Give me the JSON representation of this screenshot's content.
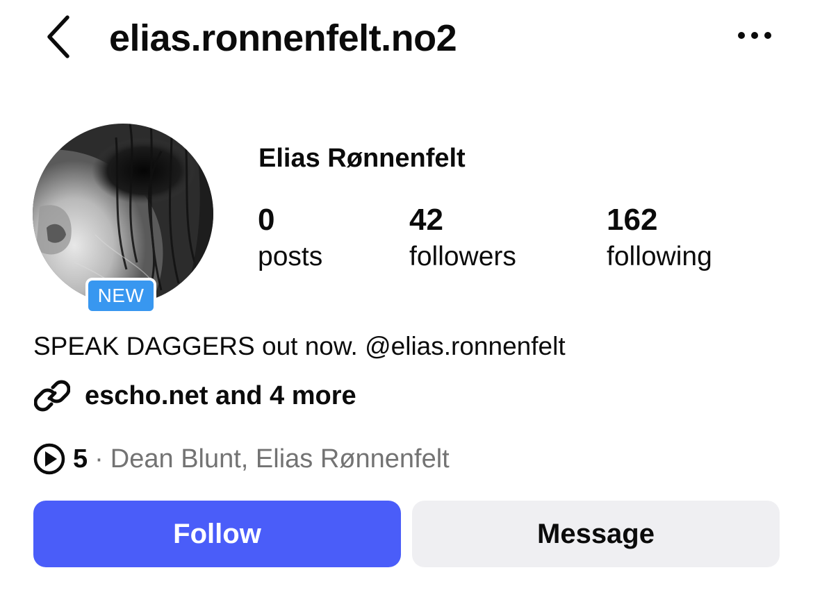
{
  "header": {
    "username": "elias.ronnenfelt.no2",
    "back_icon": "chevron-left-icon",
    "more_icon": "more-horizontal-icon"
  },
  "profile": {
    "full_name": "Elias Rønnenfelt",
    "new_badge": "NEW",
    "avatar_icon": "profile-photo"
  },
  "stats": {
    "posts": {
      "value": "0",
      "label": "posts"
    },
    "followers": {
      "value": "42",
      "label": "followers"
    },
    "following": {
      "value": "162",
      "label": "following"
    }
  },
  "bio": {
    "text": "SPEAK DAGGERS out now. @elias.ronnenfelt",
    "links_text": "escho.net and 4 more",
    "link_icon": "link-icon"
  },
  "threads": {
    "icon": "play-circle-icon",
    "count": "5",
    "separator": "·",
    "names": "Dean Blunt, Elias Rønnenfelt"
  },
  "actions": {
    "follow_label": "Follow",
    "message_label": "Message"
  },
  "colors": {
    "follow_button": "#4a5df9",
    "message_button": "#efeff2",
    "new_badge": "#3897f0",
    "muted_text": "#737373",
    "primary_text": "#0b0b0b"
  }
}
